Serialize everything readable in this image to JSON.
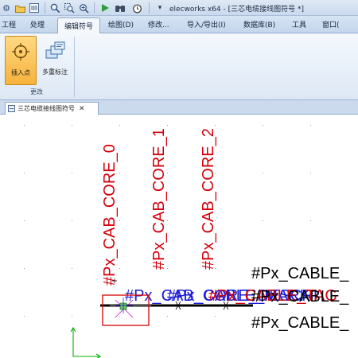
{
  "titlebar": {
    "title": "elecworks x64 - [三芯电缆接线图符号 *]",
    "dropdown_glyph": "▾"
  },
  "ribbon_tabs": [
    {
      "label": "工程"
    },
    {
      "label": "处理"
    },
    {
      "label": "编辑符号",
      "active": true
    },
    {
      "label": "绘图(D)"
    },
    {
      "label": "修改..."
    },
    {
      "label": "导入/导出(I)"
    },
    {
      "label": "数据库(B)"
    },
    {
      "label": "工具"
    },
    {
      "label": "窗口("
    }
  ],
  "ribbon": {
    "insert_point_label": "插入点",
    "multi_label_label": "多重标注",
    "group_label": "更改"
  },
  "document_tab": {
    "title": "三芯电缆接线图符号",
    "close_glyph": "✕"
  },
  "canvas": {
    "vertical_labels": [
      "#Px_CAB_CORE_0",
      "#Px_CAB_CORE_1",
      "#Px_CAB_CORE_2"
    ],
    "overlap_label": "#Px_CAB_CORE_DESCRI",
    "overlap_label_2": "#Px_CABLE_MARK",
    "overlap_label_3": "#Px_CABLE_TAG",
    "cable_labels": [
      "#Px_CABLE_",
      "#Px_CABLE_",
      "#Px_CABLE_"
    ],
    "colors": {
      "red_text": "#d4000c",
      "blue_text": "#1b1bd9",
      "black_text": "#000000",
      "selection_box": "#d60000",
      "ucs_axis": "#00b200",
      "grid_dot": "#9a9a9a"
    }
  }
}
